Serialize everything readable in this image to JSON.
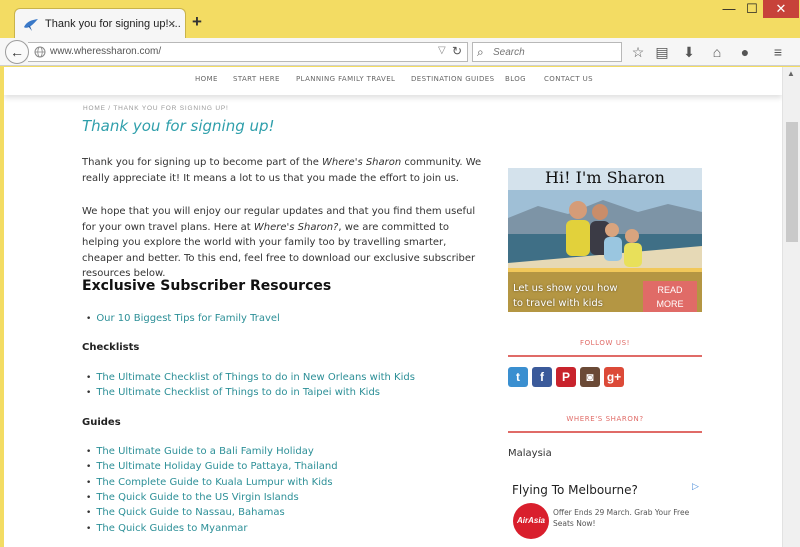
{
  "browser": {
    "tab_title": "Thank you for signing up! ...",
    "tab_close": "×",
    "new_tab": "+",
    "url": "www.wheressharon.com/",
    "search_placeholder": "Search",
    "window_min": "—",
    "window_max": "☐",
    "window_close": "✕"
  },
  "site_nav": [
    "HOME",
    "START HERE",
    "PLANNING FAMILY TRAVEL",
    "DESTINATION GUIDES",
    "BLOG",
    "CONTACT US"
  ],
  "breadcrumb": "HOME / THANK YOU FOR SIGNING UP!",
  "page_title": "Thank you for signing up!",
  "intro": {
    "p1_a": "Thank you for signing up to become part of the ",
    "p1_em": "Where's Sharon",
    "p1_b": " community. We really appreciate it! It means a lot to us that you made the effort to join us.",
    "p2_a": "We hope that you will enjoy our regular updates and that you find them useful for your own travel plans. Here at ",
    "p2_em": "Where's Sharon?",
    "p2_b": ", we are committed to helping you explore the world with your family too by travelling smarter, cheaper and better. To this end, feel free to download our exclusive subscriber resources below."
  },
  "resources_heading": "Exclusive Subscriber Resources",
  "top_links": [
    "Our 10 Biggest Tips for Family Travel"
  ],
  "checklists_heading": "Checklists",
  "checklists": [
    "The Ultimate Checklist of Things to do in New Orleans with Kids",
    "The Ultimate Checklist of Things to do in Taipei with Kids"
  ],
  "guides_heading": "Guides",
  "guides": [
    "The Ultimate Guide to a Bali Family Holiday",
    "The Ultimate Holiday Guide to Pattaya, Thailand",
    "The Complete Guide to Kuala Lumpur with Kids",
    "The Quick Guide to the US Virgin Islands",
    "The Quick Guide to Nassau, Bahamas",
    "The Quick Guides to Myanmar"
  ],
  "sidebar": {
    "promo_title": "Hi! I'm Sharon",
    "promo_line1": "Let us show you how",
    "promo_line2": "to travel with kids",
    "read_more_1": "READ",
    "read_more_2": "MORE",
    "follow_heading": "FOLLOW US!",
    "social": [
      {
        "icon": "twitter-icon",
        "glyph": "t",
        "color": "#3a8fd0"
      },
      {
        "icon": "facebook-icon",
        "glyph": "f",
        "color": "#3b5a9a"
      },
      {
        "icon": "pinterest-icon",
        "glyph": "P",
        "color": "#c8232c"
      },
      {
        "icon": "instagram-icon",
        "glyph": "◙",
        "color": "#6b4a36"
      },
      {
        "icon": "google-plus-icon",
        "glyph": "g+",
        "color": "#dc4a38"
      }
    ],
    "where_heading": "WHERE'S SHARON?",
    "location": "Malaysia",
    "ad_title": "Flying To Melbourne?",
    "ad_play": "▷",
    "ad_logo": "AirAsia",
    "ad_text": "Offer Ends 29 March. Grab Your Free Seats Now!"
  }
}
